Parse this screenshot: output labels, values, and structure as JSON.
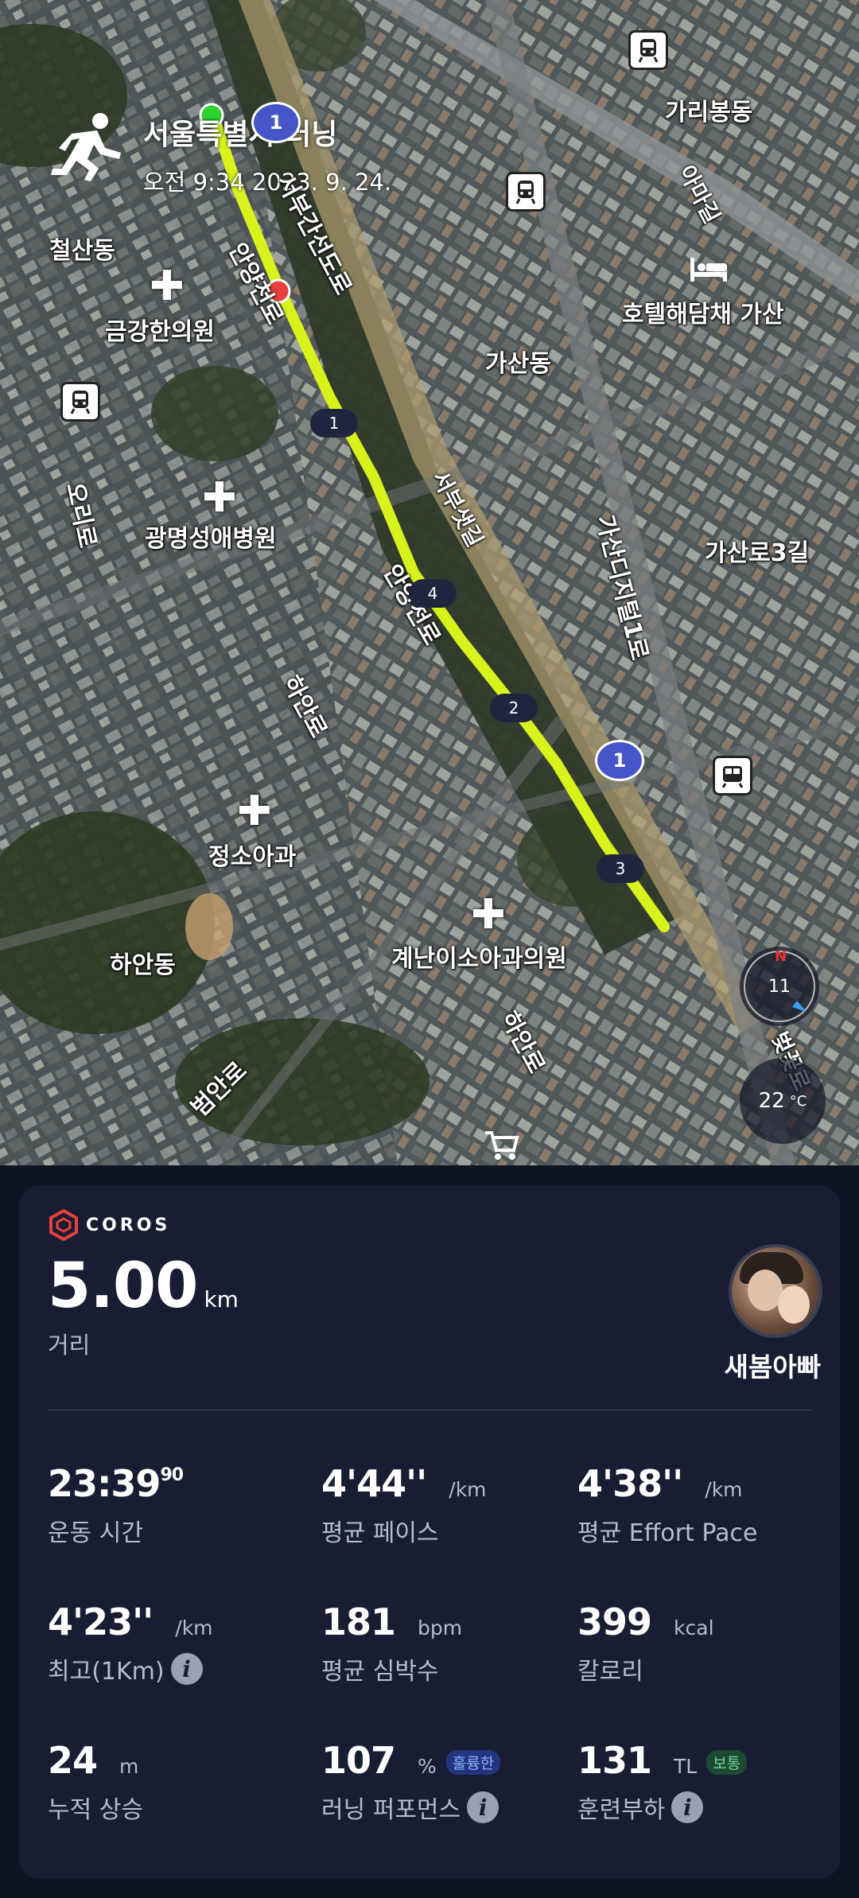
{
  "map": {
    "activity_title": "서울특별시 러닝",
    "activity_datetime": "오전 9:34 2023. 9. 24.",
    "labels": {
      "garibong": "가리봉동",
      "amagil": "아마길",
      "cheolsan": "철산동",
      "geumgang_clinic": "금강한의원",
      "hotel": "호텔해담채 가산",
      "gasan": "가산동",
      "seobu_ganseon": "서부간선도로",
      "anyangcheon_ro_top": "안양천로",
      "ori_ro": "오리로",
      "gwangmyeong_hospital": "광명성애병원",
      "seobu_bikepath": "서부샛길",
      "gasan_digital1": "가산디지털1로",
      "gasan_ro3": "가산로3길",
      "anyangcheon_ro_mid": "안양천로",
      "hahn_ro_mid": "하안로",
      "jeongso_pediatrics": "정소아과",
      "hahn_dong": "하안동",
      "gyenan_clinic": "계난이소아과의원",
      "hahn_ro_low": "하안로",
      "beoman_ro": "범안로",
      "seobu_low": "서부샛길",
      "beotkkot_ro": "벚꽃로"
    },
    "km_markers": [
      "1",
      "4",
      "2",
      "3"
    ],
    "route_shield_top": "1",
    "route_shield_mid": "1",
    "compass": {
      "north": "N",
      "value": "11"
    },
    "temperature": {
      "value": "22",
      "unit": "°C"
    },
    "route_color": "#d8f21c"
  },
  "card": {
    "brand": "COROS",
    "distance": {
      "value": "5.00",
      "unit": "km",
      "label": "거리"
    },
    "username": "새봄아빠",
    "stats": [
      {
        "value": "23:39",
        "sup": "90",
        "unit": "",
        "label": "운동 시간"
      },
      {
        "value": "4'44''",
        "unit": "/km",
        "label": "평균 페이스"
      },
      {
        "value": "4'38''",
        "unit": "/km",
        "label": "평균 Effort Pace"
      },
      {
        "value": "4'23''",
        "unit": "/km",
        "label": "최고(1Km)"
      },
      {
        "value": "181",
        "unit": "bpm",
        "label": "평균 심박수"
      },
      {
        "value": "399",
        "unit": "kcal",
        "label": "칼로리"
      },
      {
        "value": "24",
        "unit": "m",
        "label": "누적 상승"
      },
      {
        "value": "107",
        "unit": "%",
        "badge": "훌륭한",
        "label": "러닝 퍼포먼스"
      },
      {
        "value": "131",
        "unit": "TL",
        "badge": "보통",
        "label": "훈련부하"
      }
    ]
  }
}
